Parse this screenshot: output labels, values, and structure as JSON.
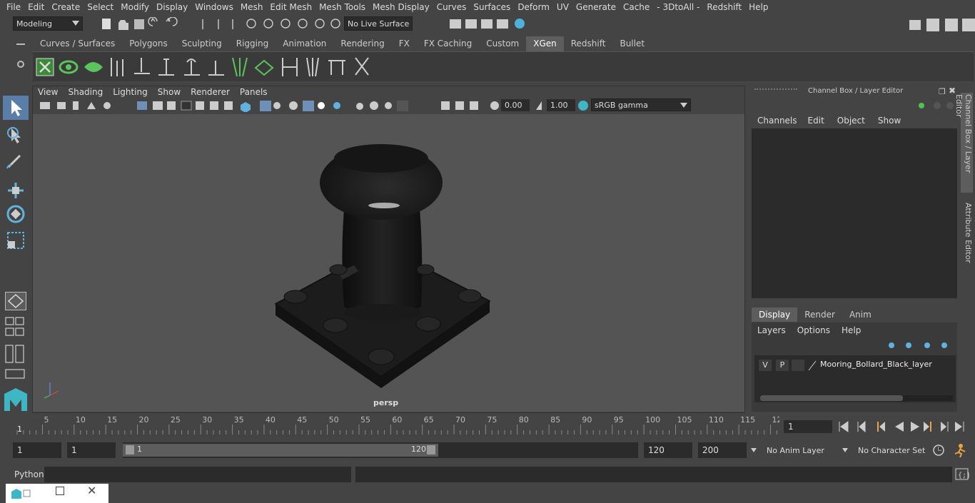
{
  "menubar": [
    "File",
    "Edit",
    "Create",
    "Select",
    "Modify",
    "Display",
    "Windows",
    "Mesh",
    "Edit Mesh",
    "Mesh Tools",
    "Mesh Display",
    "Curves",
    "Surfaces",
    "Deform",
    "UV",
    "Generate",
    "Cache",
    "- 3DtoAll -",
    "Redshift",
    "Help"
  ],
  "status": {
    "mode": "Modeling",
    "live_surface": "No Live Surface"
  },
  "shelf_tabs": [
    "Curves / Surfaces",
    "Polygons",
    "Sculpting",
    "Rigging",
    "Animation",
    "Rendering",
    "FX",
    "FX Caching",
    "Custom",
    "XGen",
    "Redshift",
    "Bullet"
  ],
  "shelf_active": "XGen",
  "viewport": {
    "menu": [
      "View",
      "Shading",
      "Lighting",
      "Show",
      "Renderer",
      "Panels"
    ],
    "exposure": "0.00",
    "gamma": "1.00",
    "color_space": "sRGB gamma",
    "camera_label": "persp"
  },
  "channel_box": {
    "title": "Channel Box / Layer Editor",
    "menu": [
      "Channels",
      "Edit",
      "Object",
      "Show"
    ],
    "side_tab_1": "Channel Box / Layer Editor",
    "side_tab_2": "Attribute Editor"
  },
  "layer_editor": {
    "tabs": [
      "Display",
      "Render",
      "Anim"
    ],
    "active_tab": "Display",
    "menu": [
      "Layers",
      "Options",
      "Help"
    ],
    "layer": {
      "v": "V",
      "p": "P",
      "name": "Mooring_Bollard_Black_layer"
    }
  },
  "timeline": {
    "ticks": [
      "5",
      "10",
      "15",
      "20",
      "25",
      "30",
      "35",
      "40",
      "45",
      "50",
      "55",
      "60",
      "65",
      "70",
      "75",
      "80",
      "85",
      "90",
      "95",
      "100",
      "105",
      "110",
      "115",
      "12"
    ],
    "current_marker": "1",
    "current_frame": "1"
  },
  "range": {
    "start": "1",
    "playback_start": "1",
    "slider_start": "1",
    "slider_end": "120",
    "playback_end": "120",
    "end": "200",
    "anim_layer": "No Anim Layer",
    "character_set": "No Character Set"
  },
  "cmdline": {
    "label": "Python"
  }
}
